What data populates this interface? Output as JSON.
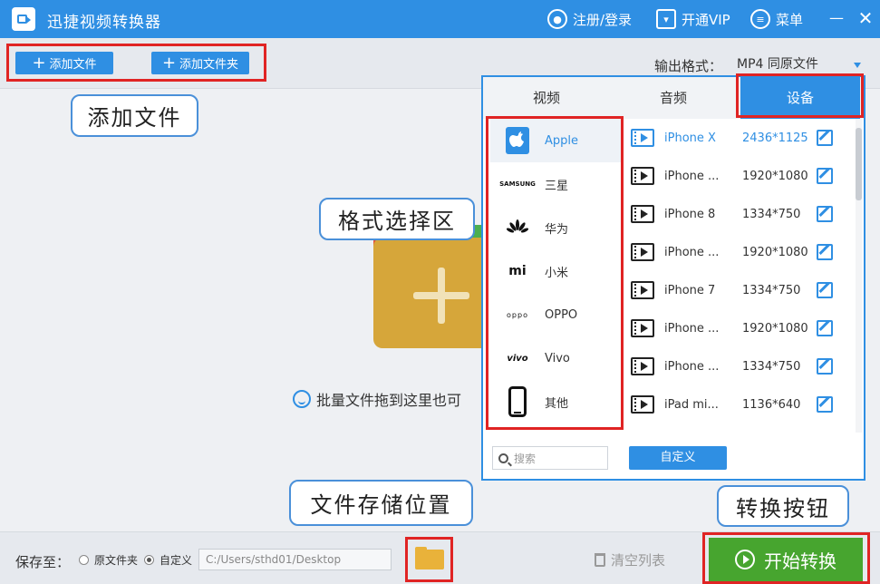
{
  "titlebar": {
    "title": "迅捷视频转换器",
    "register_login": "注册/登录",
    "vip": "开通VIP",
    "menu": "菜单",
    "minimize": "—",
    "close": "✕"
  },
  "toolbar": {
    "add_file": "添加文件",
    "add_folder": "添加文件夹",
    "output_format_label": "输出格式：",
    "output_format_value": "MP4  同原文件"
  },
  "callouts": {
    "add_file": "添加文件",
    "format_area": "格式选择区",
    "storage_location": "文件存储位置",
    "convert_button": "转换按钮"
  },
  "drop_area": {
    "hint": "批量文件拖到这里也可"
  },
  "format_panel": {
    "tabs": [
      {
        "label": "视频",
        "active": false
      },
      {
        "label": "音频",
        "active": false
      },
      {
        "label": "设备",
        "active": true
      }
    ],
    "brands": [
      {
        "name": "Apple",
        "icon": "apple-icon",
        "selected": true
      },
      {
        "name": "三星",
        "icon": "samsung-logo",
        "selected": false
      },
      {
        "name": "华为",
        "icon": "huawei-logo",
        "selected": false
      },
      {
        "name": "小米",
        "icon": "xiaomi-logo",
        "selected": false
      },
      {
        "name": "OPPO",
        "icon": "oppo-logo",
        "selected": false
      },
      {
        "name": "Vivo",
        "icon": "vivo-logo",
        "selected": false
      },
      {
        "name": "其他",
        "icon": "phone-icon",
        "selected": false
      }
    ],
    "devices": [
      {
        "name": "iPhone X",
        "resolution": "2436*1125",
        "selected": true
      },
      {
        "name": "iPhone ...",
        "resolution": "1920*1080",
        "selected": false
      },
      {
        "name": "iPhone 8",
        "resolution": "1334*750",
        "selected": false
      },
      {
        "name": "iPhone ...",
        "resolution": "1920*1080",
        "selected": false
      },
      {
        "name": "iPhone 7",
        "resolution": "1334*750",
        "selected": false
      },
      {
        "name": "iPhone ...",
        "resolution": "1920*1080",
        "selected": false
      },
      {
        "name": "iPhone ...",
        "resolution": "1334*750",
        "selected": false
      },
      {
        "name": "iPad mi...",
        "resolution": "1136*640",
        "selected": false
      }
    ],
    "search_placeholder": "搜索",
    "custom_button": "自定义"
  },
  "bottombar": {
    "save_to_label": "保存至：",
    "option_original": "原文件夹",
    "option_custom": "自定义",
    "selected_option": "自定义",
    "path": "C:/Users/sthd01/Desktop",
    "clear_list": "清空列表",
    "start_convert": "开始转换"
  },
  "colors": {
    "accent": "#2f8fe3",
    "start_green": "#47a52f",
    "annotation_red": "#e02424"
  }
}
